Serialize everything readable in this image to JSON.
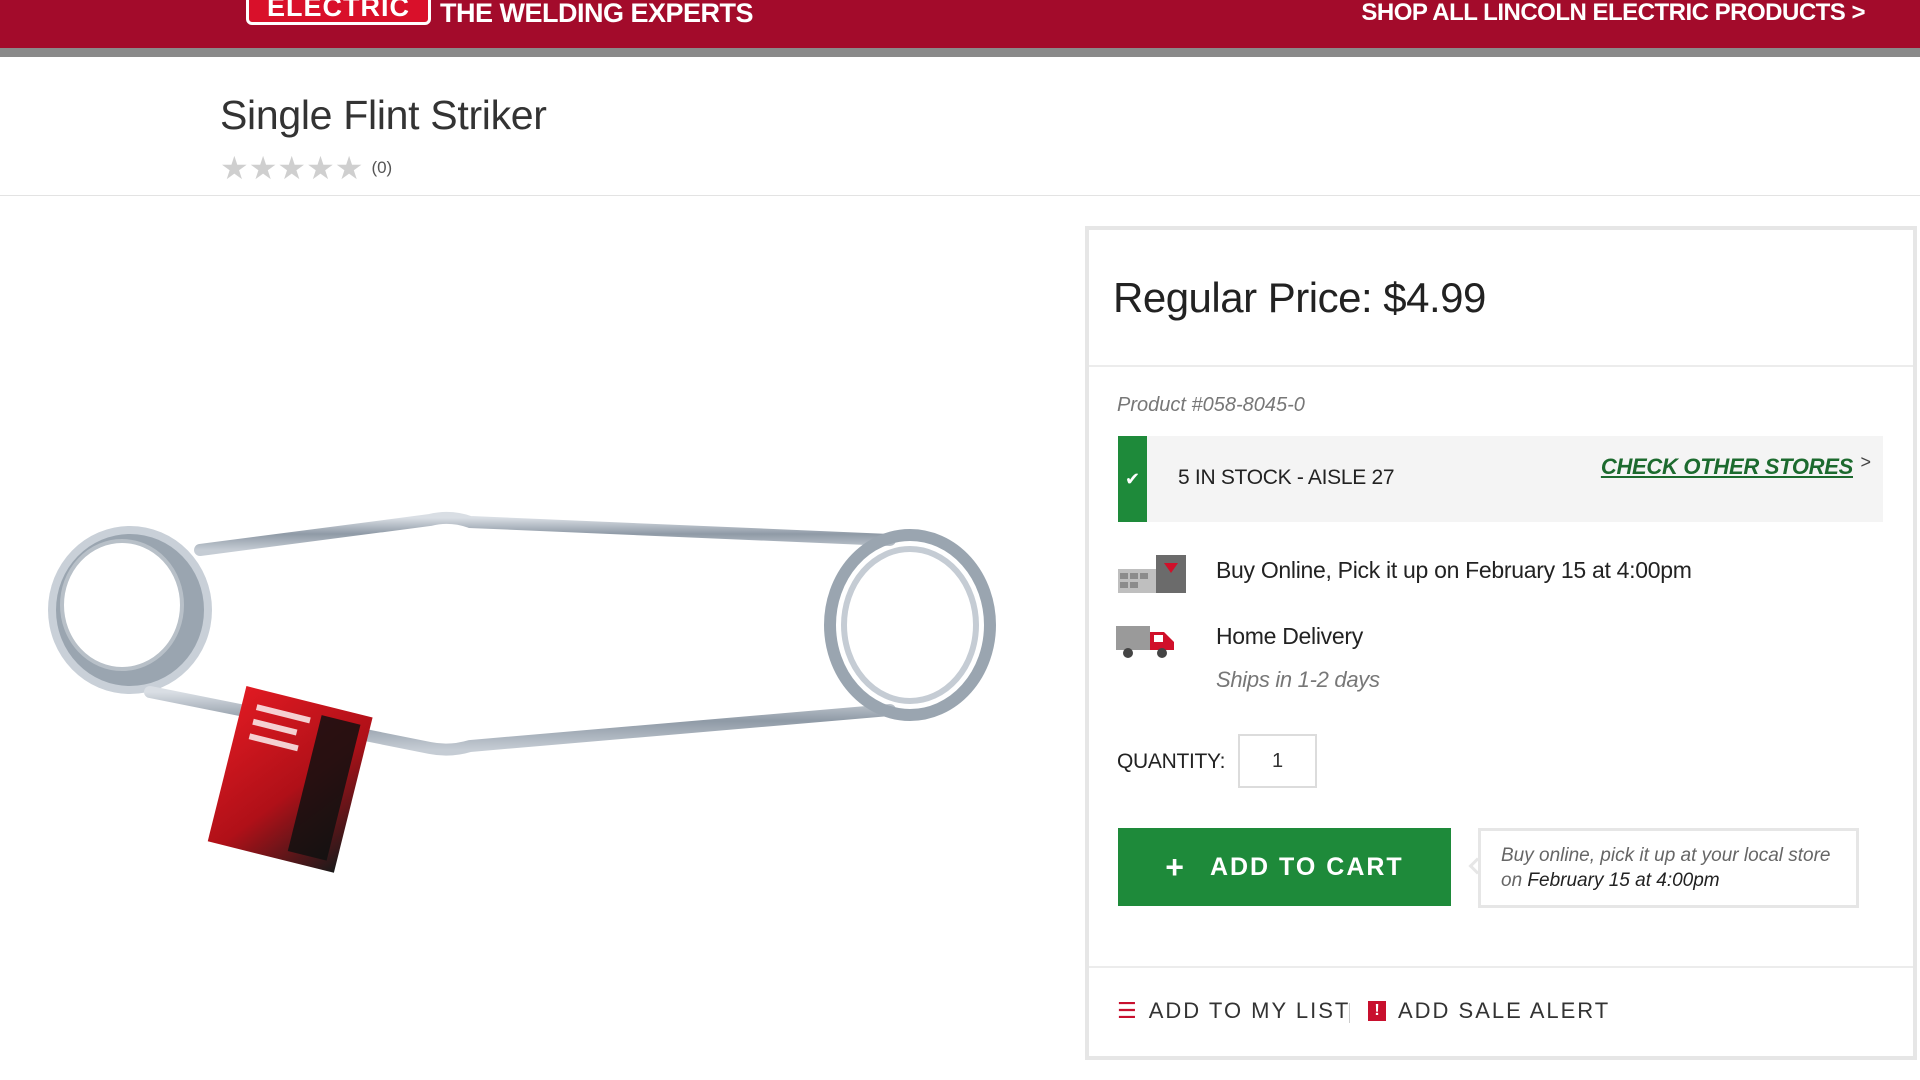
{
  "banner": {
    "brand": "ELECTRIC",
    "tagline": "THE WELDING EXPERTS",
    "shop_all": "SHOP ALL LINCOLN ELECTRIC PRODUCTS >",
    "color": "#a30b2b"
  },
  "product": {
    "title": "Single Flint Striker",
    "rating_stars": 0,
    "review_count": "(0)"
  },
  "buybox": {
    "price": "Regular Price: $4.99",
    "product_number": "Product #058-8045-0",
    "stock": "5 IN STOCK - AISLE 27",
    "check_stores": "CHECK OTHER STORES",
    "check_stores_chevron": ">",
    "pickup": "Buy Online, Pick it up on February 15 at 4:00pm",
    "delivery": "Home Delivery",
    "ships": "Ships in 1-2 days",
    "quantity_label": "QUANTITY:",
    "quantity_value": "1",
    "add_to_cart": "ADD TO CART",
    "pickup_note_prefix": "Buy online, pick it up at your local store",
    "pickup_note_on": "on",
    "pickup_note_date": "February 15 at 4:00pm",
    "add_to_list": "ADD TO MY LIST",
    "add_sale_alert": "ADD SALE ALERT",
    "accent_color": "#1e8a3a",
    "alert_color": "#c8102e"
  },
  "icons": {
    "check": "check-icon",
    "store_pickup": "store-pickup-icon",
    "delivery_truck": "delivery-truck-icon",
    "plus": "plus-icon",
    "list": "list-icon",
    "alert": "alert-icon"
  }
}
